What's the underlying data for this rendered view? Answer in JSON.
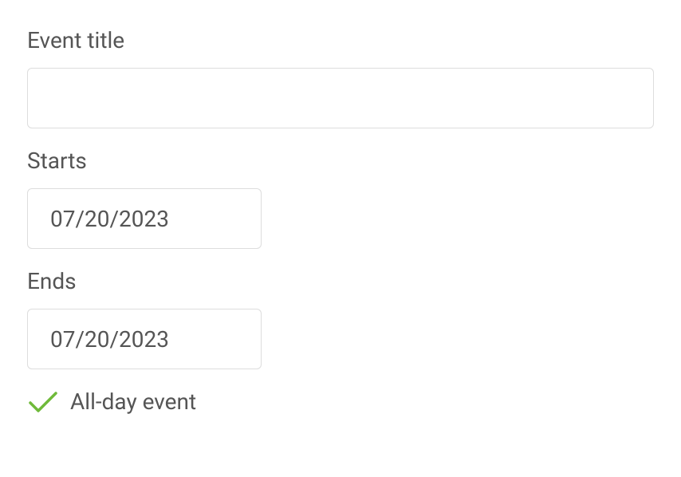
{
  "form": {
    "event_title": {
      "label": "Event title",
      "value": ""
    },
    "starts": {
      "label": "Starts",
      "value": "07/20/2023"
    },
    "ends": {
      "label": "Ends",
      "value": "07/20/2023"
    },
    "all_day": {
      "label": "All-day event",
      "checked": true
    }
  },
  "colors": {
    "accent": "#6fba3a"
  }
}
